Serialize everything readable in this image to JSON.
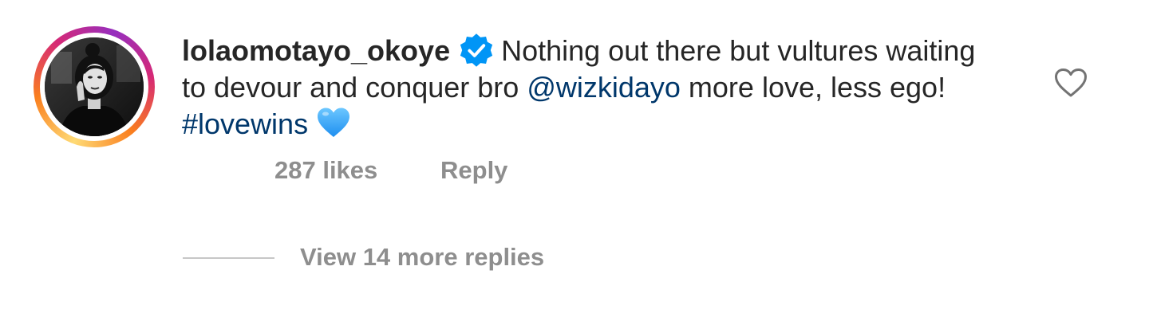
{
  "comment": {
    "username": "lolaomotayo_okoye",
    "verified": true,
    "text_part1": "Nothing out there but vultures waiting to devour and conquer bro ",
    "mention": "@wizkidayo",
    "text_part2": " more love, less ego! ",
    "hashtag": "#lovewins",
    "emoji": "blue-heart-emoji",
    "likes_label": "287 likes",
    "reply_label": "Reply",
    "view_replies_label": "View 14 more replies"
  },
  "icons": {
    "like": "heart-outline-icon",
    "verified": "verified-badge-icon"
  },
  "colors": {
    "link": "#00376b",
    "meta": "#8e8e8e",
    "verified": "#0095f6",
    "emoji_heart": "#3ea6ff"
  }
}
